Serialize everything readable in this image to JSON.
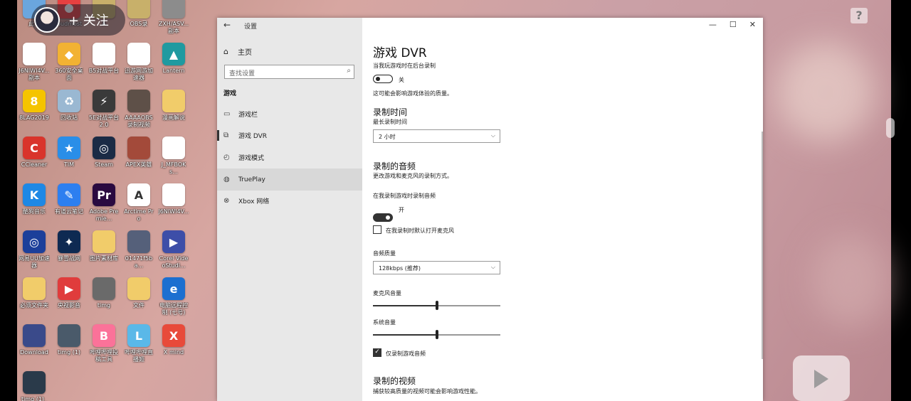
{
  "overlay": {
    "follow_label": "+ 关注",
    "help_badge": "?"
  },
  "desktop": {
    "icons": [
      {
        "label": "此电",
        "color": "#6aa6de",
        "glyph": ""
      },
      {
        "label": "Gudmost",
        "color": "#e64040",
        "glyph": "●"
      },
      {
        "label": "A",
        "color": "#c8b06a",
        "glyph": ""
      },
      {
        "label": "OBS录",
        "color": "#c8b06a",
        "glyph": ""
      },
      {
        "label": "ZXH/ASV... 副本",
        "color": "#8c8c8c",
        "glyph": ""
      },
      {
        "label": "J6NIWI4V... 副本",
        "color": "#ffffff",
        "glyph": ""
      },
      {
        "label": "360安全桌面",
        "color": "#f2b233",
        "glyph": "◆"
      },
      {
        "label": "B5对战平台",
        "color": "#ffffff",
        "glyph": ""
      },
      {
        "label": "迅游网游加速器",
        "color": "#ffffff",
        "glyph": ""
      },
      {
        "label": "Lantern",
        "color": "#1f9aa0",
        "glyph": "▲"
      },
      {
        "label": "8LAG2019",
        "color": "#f5c400",
        "glyph": "8"
      },
      {
        "label": "回收站",
        "color": "#9ab8d2",
        "glyph": "♻"
      },
      {
        "label": "5E对战平台2.0",
        "color": "#3a3a3a",
        "glyph": "⚡"
      },
      {
        "label": "AAAAOBS录制视频",
        "color": "#5e5048",
        "glyph": ""
      },
      {
        "label": "漫画解说",
        "color": "#f1cc6a",
        "glyph": ""
      },
      {
        "label": "CCleaner",
        "color": "#d9342b",
        "glyph": "C"
      },
      {
        "label": "TIM",
        "color": "#2a8ee8",
        "glyph": "★"
      },
      {
        "label": "Steam",
        "color": "#1b2b45",
        "glyph": "◎"
      },
      {
        "label": "APEX英雄",
        "color": "#a34a3a",
        "glyph": ""
      },
      {
        "label": "J_MFBOKs...",
        "color": "#ffffff",
        "glyph": ""
      },
      {
        "label": "酷狗音乐",
        "color": "#1e88e5",
        "glyph": "K"
      },
      {
        "label": "有道云笔记",
        "color": "#2d7ff0",
        "glyph": "✎"
      },
      {
        "label": "Adobe Premie...",
        "color": "#2a0a40",
        "glyph": "Pr"
      },
      {
        "label": "Arctime Pro",
        "color": "#ffffff",
        "glyph": "A"
      },
      {
        "label": "J6NIWI4V...",
        "color": "#ffffff",
        "glyph": ""
      },
      {
        "label": "网易UU加速器",
        "color": "#1c3f9a",
        "glyph": "◎"
      },
      {
        "label": "暴雪战网",
        "color": "#0e2a52",
        "glyph": "✦"
      },
      {
        "label": "图片素材库",
        "color": "#f1cc6a",
        "glyph": ""
      },
      {
        "label": "01471f5ba...",
        "color": "#55607a",
        "glyph": ""
      },
      {
        "label": "Corel VideoStudi...",
        "color": "#3d4ea8",
        "glyph": "▶"
      },
      {
        "label": "必须文件夹",
        "color": "#f1cc6a",
        "glyph": ""
      },
      {
        "label": "央视影音",
        "color": "#e03c3c",
        "glyph": "▶"
      },
      {
        "label": "timg",
        "color": "#6a6a6a",
        "glyph": ""
      },
      {
        "label": "文件",
        "color": "#f1cc6a",
        "glyph": ""
      },
      {
        "label": "电脑远程控制 (七号)",
        "color": "#1c6fd0",
        "glyph": "e"
      },
      {
        "label": "Download",
        "color": "#3a4a8a",
        "glyph": ""
      },
      {
        "label": "timg (1)",
        "color": "#4a5a6a",
        "glyph": ""
      },
      {
        "label": "哔哩哔哩投稿工具",
        "color": "#fb7299",
        "glyph": "B"
      },
      {
        "label": "哔哩哔哩直播姬",
        "color": "#5ab8e8",
        "glyph": "L"
      },
      {
        "label": "X mind",
        "color": "#e84a3a",
        "glyph": "X"
      },
      {
        "label": "timg (1)_副本",
        "color": "#2a3a4a",
        "glyph": ""
      }
    ]
  },
  "window": {
    "title": "设置",
    "back": "←",
    "controls": {
      "minimize": "—",
      "maximize": "☐",
      "close": "✕"
    },
    "home_icon": "⌂",
    "home_label": "主页",
    "search_placeholder": "查找设置",
    "search_icon": "⌕",
    "section_label": "游戏",
    "nav_items": [
      {
        "label": "游戏栏",
        "icon": "▭"
      },
      {
        "label": "游戏 DVR",
        "icon": "⧉"
      },
      {
        "label": "游戏模式",
        "icon": "◴"
      },
      {
        "label": "TruePlay",
        "icon": "◍"
      },
      {
        "label": "Xbox 网络",
        "icon": "⊗"
      }
    ]
  },
  "content": {
    "title": "游戏 DVR",
    "bg_record_label": "当我玩游戏时在后台录制",
    "bg_record_state": "关",
    "bg_record_note": "这可能会影响游戏体验的质量。",
    "record_time_heading": "录制时间",
    "max_record_label": "最长录制时间",
    "max_record_value": "2 小时",
    "audio_heading": "录制的音频",
    "audio_desc": "更改游戏和麦克风的录制方式。",
    "record_audio_label": "在我录制游戏时录制音频",
    "record_audio_state": "开",
    "mic_default_label": "在我录制时默认打开麦克风",
    "audio_quality_label": "音频质量",
    "audio_quality_value": "128kbps (推荐)",
    "mic_volume_label": "麦克风音量",
    "mic_volume_level": 0.5,
    "system_volume_label": "系统音量",
    "system_volume_level": 0.5,
    "game_audio_only_label": "仅录制游戏音频",
    "video_heading": "录制的视频",
    "video_desc": "捕获较高质量的视频可能会影响游戏性能。",
    "chevron": "⌵"
  }
}
